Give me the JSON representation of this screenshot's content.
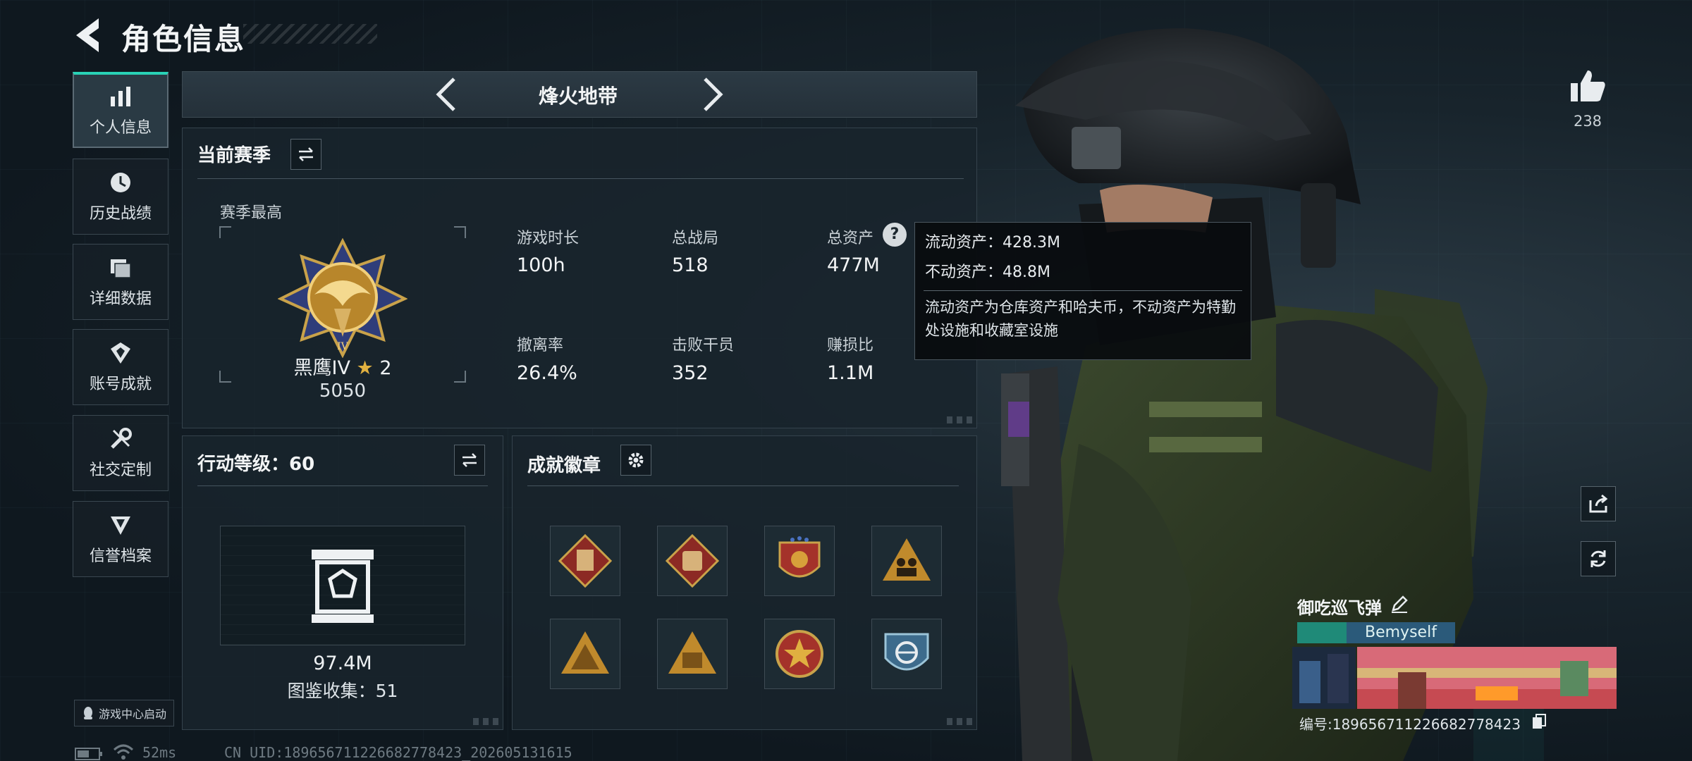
{
  "header": {
    "title": "角色信息"
  },
  "sidebar": {
    "items": [
      {
        "label": "个人信息",
        "icon": "bar-chart-icon",
        "active": true
      },
      {
        "label": "历史战绩",
        "icon": "history-icon"
      },
      {
        "label": "详细数据",
        "icon": "folder-icon"
      },
      {
        "label": "账号成就",
        "icon": "achievement-icon"
      },
      {
        "label": "社交定制",
        "icon": "wrench-icon"
      },
      {
        "label": "信誉档案",
        "icon": "reputation-icon"
      }
    ],
    "launch_label": "游戏中心启动"
  },
  "mode": {
    "label": "烽火地带"
  },
  "season": {
    "title": "当前赛季",
    "best_label": "赛季最高",
    "rank_name": "黑鹰IV",
    "rank_stars": "2",
    "rank_score": "5050",
    "stats": [
      {
        "label": "游戏时长",
        "value": "100h"
      },
      {
        "label": "总战局",
        "value": "518"
      },
      {
        "label": "总资产",
        "value": "477M"
      },
      {
        "label": "撤离率",
        "value": "26.4%"
      },
      {
        "label": "击败干员",
        "value": "352"
      },
      {
        "label": "赚损比",
        "value": "1.1M"
      }
    ]
  },
  "tooltip": {
    "liquid": "流动资产：428.3M",
    "fixed": "不动资产：48.8M",
    "desc": "流动资产为仓库资产和哈夫币，不动资产为特勤处设施和收藏室设施"
  },
  "action_level": {
    "title": "行动等级：60",
    "value": "97.4M",
    "collection": "图鉴收集：51"
  },
  "badges": {
    "title": "成就徽章",
    "items": [
      {
        "icon": "vest-badge-icon",
        "color": "#8c2a24"
      },
      {
        "icon": "backpack-badge-icon",
        "color": "#8c2a24"
      },
      {
        "icon": "emblem-badge-icon",
        "color": "#b8862b"
      },
      {
        "icon": "soldiers-badge-icon",
        "color": "#c08a2c"
      },
      {
        "icon": "gold-pyramid-badge-icon",
        "color": "#c08a2c"
      },
      {
        "icon": "gold-case-badge-icon",
        "color": "#c08a2c"
      },
      {
        "icon": "star-medal-badge-icon",
        "color": "#a4322a"
      },
      {
        "icon": "blue-medal-badge-icon",
        "color": "#3d6b8c"
      }
    ]
  },
  "likes": {
    "count": "238"
  },
  "player": {
    "name": "御吃巡飞弹",
    "tag": "Bemyself",
    "id_text": "编号:18965671122668277842​3"
  },
  "status": {
    "ping": "52ms",
    "uid": "CN UID:18965671122668277842​3_202605131615"
  },
  "colors": {
    "accent": "#29d2b6",
    "panel": "#18242c",
    "gold": "#c9a24a"
  }
}
